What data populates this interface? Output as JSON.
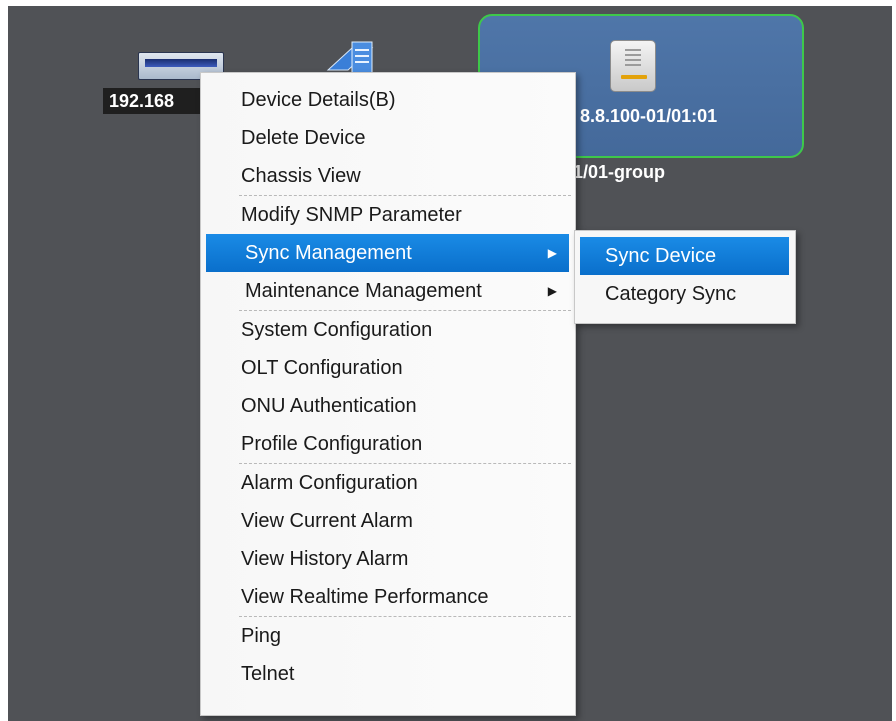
{
  "topology": {
    "olt_label": "192.168",
    "switch_label": "",
    "onu_label": "8.8.100-01/01:01",
    "group_label": "er-01/01-group"
  },
  "context_menu": {
    "items": [
      {
        "label": "Device Details(B)",
        "mnemonic": "B"
      },
      {
        "label": "Delete Device",
        "mnemonic": "D"
      },
      {
        "label": "Chassis View",
        "mnemonic": "V"
      },
      {
        "label": "Modify SNMP Parameter",
        "mnemonic": "M"
      },
      {
        "label": "Sync Management",
        "has_submenu": true,
        "highlighted": true
      },
      {
        "label": "Maintenance Management",
        "has_submenu": true
      },
      {
        "label": "System Configuration",
        "mnemonic": "m"
      },
      {
        "label": "OLT Configuration",
        "mnemonic": "C"
      },
      {
        "label": "ONU Authentication",
        "mnemonic": "U"
      },
      {
        "label": "Profile Configuration",
        "mnemonic": "P"
      },
      {
        "label": "Alarm Configuration",
        "mnemonic": "A"
      },
      {
        "label": "View Current Alarm",
        "mnemonic": "u"
      },
      {
        "label": "View History Alarm",
        "mnemonic": "H"
      },
      {
        "label": "View Realtime Performance",
        "mnemonic": "e"
      },
      {
        "label": "Ping",
        "mnemonic": "P"
      },
      {
        "label": "Telnet",
        "mnemonic": "T"
      }
    ]
  },
  "submenu": {
    "items": [
      {
        "label": "Sync Device",
        "mnemonic": "S",
        "highlighted": true
      },
      {
        "label": "Category Sync",
        "mnemonic": "C"
      }
    ]
  },
  "colors": {
    "canvas": "#505256",
    "selection_highlight": "#0a6fcb",
    "selected_node_border": "#3ec84a",
    "selected_node_fill": "#4a6fa2"
  },
  "icons": {
    "submenu_arrow": "triangle-right",
    "olt": "olt-chassis-icon",
    "switch": "switch-icon",
    "onu": "onu-router-icon"
  }
}
